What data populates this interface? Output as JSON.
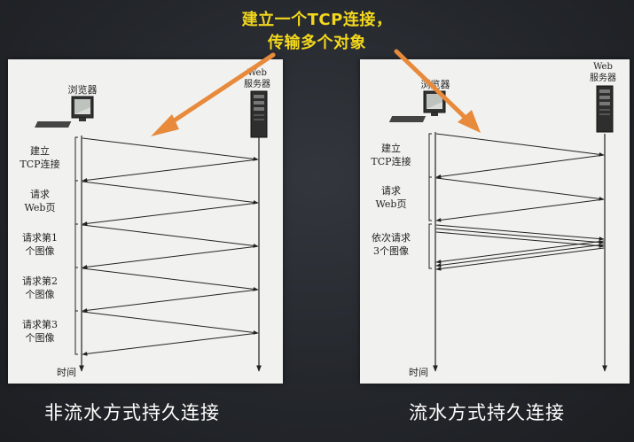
{
  "headline": {
    "line1": "建立一个TCP连接，",
    "line2": "传输多个对象"
  },
  "colors": {
    "headline": "#f3d81c",
    "arrow": "#e88a3c",
    "panel": "#f1f2f0",
    "background": "#23262b"
  },
  "left_panel": {
    "browser_label": "浏览器",
    "server_label_1": "Web",
    "server_label_2": "服务器",
    "time_label": "时间",
    "step1_l1": "建立",
    "step1_l2": "TCP连接",
    "step2_l1": "请求",
    "step2_l2": "Web页",
    "step3_l1": "请求第1",
    "step3_l2": "个图像",
    "step4_l1": "请求第2",
    "step4_l2": "个图像",
    "step5_l1": "请求第3",
    "step5_l2": "个图像",
    "caption": "非流水方式持久连接"
  },
  "right_panel": {
    "browser_label": "浏览器",
    "server_label_1": "Web",
    "server_label_2": "服务器",
    "time_label": "时间",
    "step1_l1": "建立",
    "step1_l2": "TCP连接",
    "step2_l1": "请求",
    "step2_l2": "Web页",
    "step3_l1": "依次请求",
    "step3_l2": "3个图像",
    "caption": "流水方式持久连接"
  },
  "icons": {
    "browser": "computer-icon",
    "server": "server-tower-icon",
    "annotation": "pointer-arrow"
  }
}
